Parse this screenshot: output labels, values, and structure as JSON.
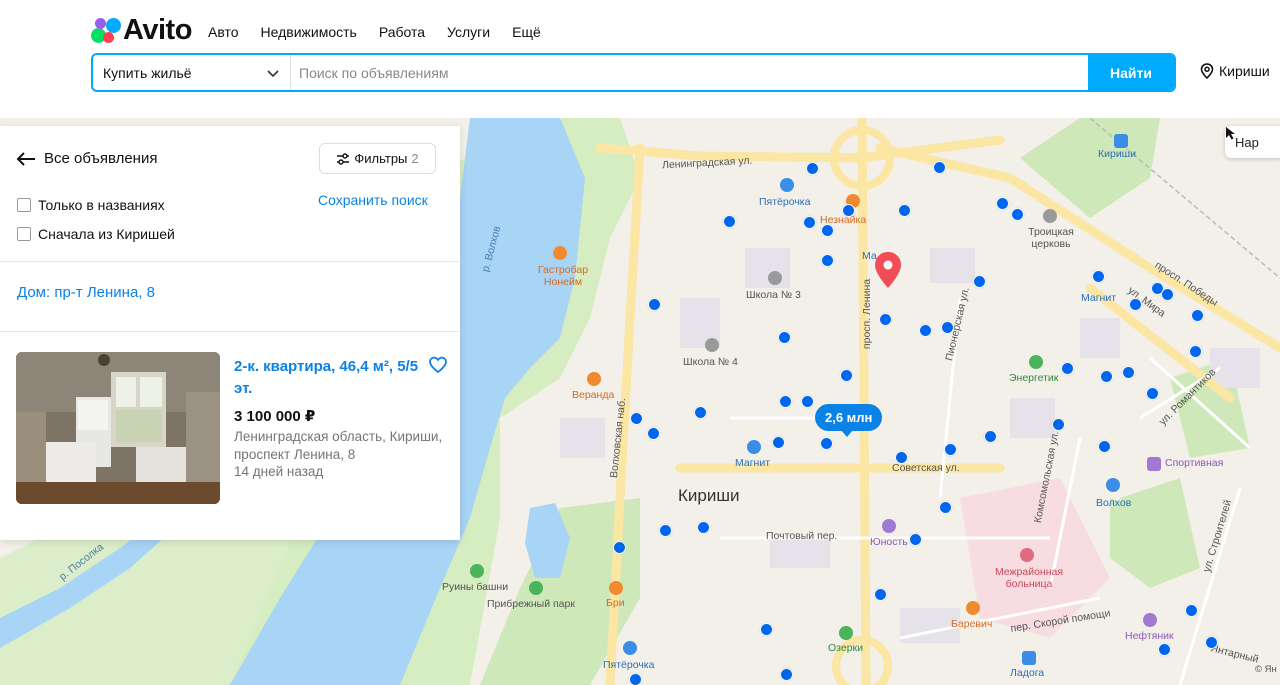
{
  "brand": {
    "name": "Avito",
    "dot_colors": [
      "#04e061",
      "#ff4053",
      "#965eeb",
      "#0af"
    ]
  },
  "top_nav": [
    "Авто",
    "Недвижимость",
    "Работа",
    "Услуги",
    "Ещё"
  ],
  "search": {
    "category": "Купить жильё",
    "placeholder": "Поиск по объявлениям",
    "button": "Найти"
  },
  "location": "Кириши",
  "panel": {
    "back_label": "Все объявления",
    "filters_label": "Фильтры",
    "filters_count": "2",
    "checkbox_titles": "Только в названиях",
    "checkbox_kirishi": "Сначала из Киришей",
    "save_search": "Сохранить поиск",
    "address": "Дом: пр-т Ленина, 8"
  },
  "listing": {
    "title": "2-к. квартира, 46,4 м², 5/5 эт.",
    "price": "3 100 000 ₽",
    "address": "Ленинградская область, Кириши, проспект Ленина, 8",
    "date": "14 дней назад"
  },
  "map": {
    "route_button": "Нар",
    "price_bubble": "2,6 млн",
    "city": "Кириши",
    "streets": {
      "leningradskaya": "Ленинградская ул.",
      "pobedy": "просп. Победы",
      "lenina": "просп. Ленина",
      "pionerskaya": "Пионерская ул.",
      "mira": "ул. Мира",
      "sovetskaya": "Советская ул.",
      "volkhovskaya": "Волховская наб.",
      "komsomolskaya": "Комсомольская ул.",
      "romantikov": "ул. Романтиков",
      "stroiteley": "ул. Строителей",
      "pochtovy": "Почтовый пер.",
      "skoroy": "пер. Скорой помощи",
      "volkov": "р. Волхов",
      "posolka": "р. Посолка",
      "yantarny": "Янтарный"
    },
    "pois": {
      "pyaterochka1": "Пятёрочка",
      "neznaika": "Незнайка",
      "ma": "Ма",
      "kirishi_station": "Кириши",
      "troitskaya": "Троицкая церковь",
      "gastrobar": "Гастробар Нонейм",
      "shkola3": "Школа № 3",
      "shkola4": "Школа № 4",
      "magnit1": "Магнит",
      "magnit2": "Магнит",
      "veranda": "Веранда",
      "energetik": "Энергетик",
      "sportivnaya": "Спортивная",
      "volkhov": "Волхов",
      "yunost": "Юность",
      "bolnitsa": "Межрайонная больница",
      "ruiny": "Руины башни",
      "pribrezhny": "Прибрежный парк",
      "bri": "Бри",
      "barevich": "Баревич",
      "neftyanik": "Нефтяник",
      "pyaterochka2": "Пятёрочка",
      "ozerki": "Озерки",
      "ladoga": "Ладога",
      "copyright": "© Ян"
    }
  },
  "colors": {
    "accent": "#00aaff",
    "link": "#0a82e6",
    "marker": "#0066ee",
    "pin": "#f24c56"
  }
}
